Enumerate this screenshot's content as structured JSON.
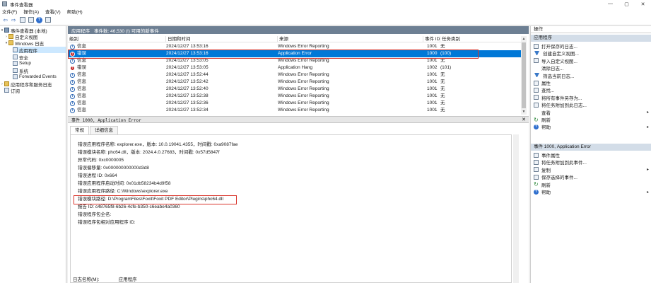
{
  "window": {
    "title": "事件查看器",
    "controls": {
      "minimize": "—",
      "maximize": "▢",
      "close": "✕"
    }
  },
  "menu": [
    "文件(F)",
    "操作(A)",
    "查看(V)",
    "帮助(H)"
  ],
  "tree": {
    "root": "事件查看器 (本地)",
    "custom_views": "自定义视图",
    "windows_logs": "Windows 日志",
    "logs": [
      "应用程序",
      "安全",
      "Setup",
      "系统",
      "Forwarded Events"
    ],
    "app_service_logs": "应用程序和服务日志",
    "subscriptions": "订阅"
  },
  "list": {
    "log_name": "应用程序",
    "count_text": "事件数: 46,530 (!) 可用的新事件",
    "columns": [
      "级别",
      "日期和时间",
      "来源",
      "事件 ID",
      "任务类别"
    ],
    "rows": [
      {
        "level": "信息",
        "type": "info",
        "datetime": "2024/12/27 13:53:16",
        "source": "Windows Error Reporting",
        "event_id": "1001",
        "category": "无"
      },
      {
        "level": "错误",
        "type": "error",
        "datetime": "2024/12/27 13:53:16",
        "source": "Application Error",
        "event_id": "1000",
        "category": "(100)",
        "selected": true
      },
      {
        "level": "信息",
        "type": "info",
        "datetime": "2024/12/27 13:53:05",
        "source": "Windows Error Reporting",
        "event_id": "1001",
        "category": "无"
      },
      {
        "level": "错误",
        "type": "error",
        "datetime": "2024/12/27 13:53:05",
        "source": "Application Hang",
        "event_id": "1002",
        "category": "(101)"
      },
      {
        "level": "信息",
        "type": "info",
        "datetime": "2024/12/27 13:52:44",
        "source": "Windows Error Reporting",
        "event_id": "1001",
        "category": "无"
      },
      {
        "level": "信息",
        "type": "info",
        "datetime": "2024/12/27 13:52:42",
        "source": "Windows Error Reporting",
        "event_id": "1001",
        "category": "无"
      },
      {
        "level": "信息",
        "type": "info",
        "datetime": "2024/12/27 13:52:40",
        "source": "Windows Error Reporting",
        "event_id": "1001",
        "category": "无"
      },
      {
        "level": "信息",
        "type": "info",
        "datetime": "2024/12/27 13:52:38",
        "source": "Windows Error Reporting",
        "event_id": "1001",
        "category": "无"
      },
      {
        "level": "信息",
        "type": "info",
        "datetime": "2024/12/27 13:52:36",
        "source": "Windows Error Reporting",
        "event_id": "1001",
        "category": "无"
      },
      {
        "level": "信息",
        "type": "info",
        "datetime": "2024/12/27 13:52:34",
        "source": "Windows Error Reporting",
        "event_id": "1001",
        "category": "无"
      }
    ]
  },
  "detail": {
    "header": "事件 1000, Application Error",
    "tabs": [
      "常规",
      "详细信息"
    ],
    "lines": [
      "错误应用程序名称: explorer.exe，版本: 10.0.19041.4355，时间戳: 0xa9087fae",
      "错误模块名称: phc64.dll，版本: 2024.4.0.27683，时间戳: 0x57d5847f",
      "异常代码: 0xc0000005",
      "错误偏移量: 0x000000000000d3d8",
      "错误进程 ID: 0x664",
      "错误应用程序启动时间: 0x01db58234b4d9f58",
      "错误应用程序路径: C:\\Windows\\explorer.exe",
      "错误模块路径: D:\\ProgramFiles\\Foxit\\Foxit PDF Editor\\Plugins\\phc64.dll",
      "报告 ID: c48765f8-6b26-4cfe-b350-c6eabe4a0360",
      "错误程序包全名:",
      "错误程序包相对应用程序 ID:"
    ],
    "footer_label": "日志名称(M):",
    "footer_value": "应用程序"
  },
  "actions": {
    "header": "操作",
    "section1": "应用程序",
    "items1": [
      "打开保存的日志...",
      "创建自定义视图...",
      "导入自定义视图...",
      "清除日志...",
      "筛选当前日志...",
      "属性",
      "查找...",
      "将所有事件另存为...",
      "将任务附加到此日志...",
      "查看",
      "刷新",
      "帮助"
    ],
    "section2": "事件 1000, Application Error",
    "items2": [
      "事件属性",
      "将任务附加到此事件...",
      "复制",
      "保存选择的事件...",
      "刷新",
      "帮助"
    ]
  }
}
